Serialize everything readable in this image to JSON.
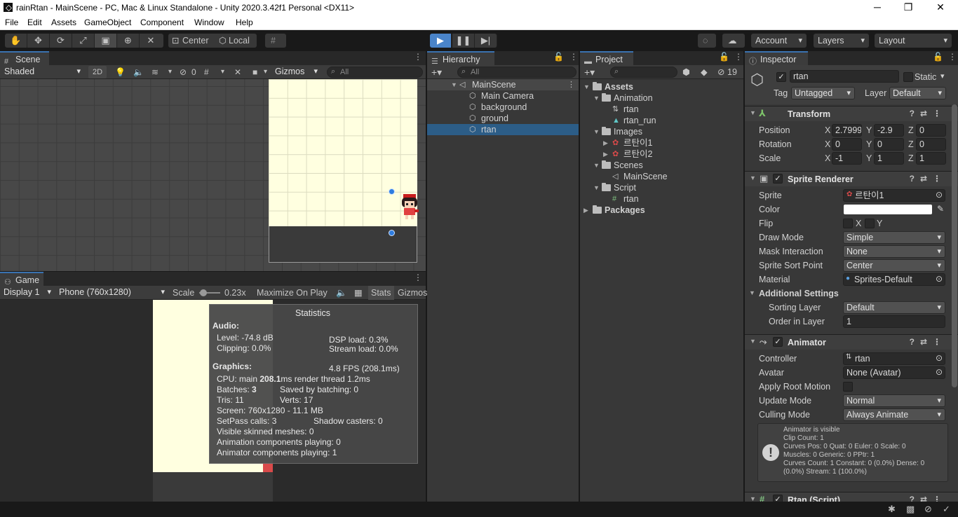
{
  "titlebar": {
    "title": "rainRtan - MainScene - PC, Mac & Linux Standalone - Unity 2020.3.42f1 Personal <DX11>",
    "minimize": "─",
    "restore": "❐",
    "close": "✕"
  },
  "menu": [
    "File",
    "Edit",
    "Assets",
    "GameObject",
    "Component",
    "Window",
    "Help"
  ],
  "toolbar": {
    "pivot": "Center",
    "space": "Local",
    "account": "Account",
    "layers": "Layers",
    "layout": "Layout"
  },
  "scene": {
    "tab": "Scene",
    "shading": "Shaded",
    "mode2d": "2D",
    "hidden_count": "0",
    "gizmos": "Gizmos",
    "search_placeholder": "All"
  },
  "game": {
    "tab": "Game",
    "display": "Display 1",
    "resolution": "Phone (760x1280)",
    "scale_label": "Scale",
    "scale_value": "0.23x",
    "maximize": "Maximize On Play",
    "stats": "Stats",
    "gizmos": "Gizmos"
  },
  "statistics": {
    "title": "Statistics",
    "audio_header": "Audio:",
    "level": "Level: -74.8 dB",
    "clipping": "Clipping: 0.0%",
    "dsp": "DSP load: 0.3%",
    "stream": "Stream load: 0.0%",
    "graphics_header": "Graphics:",
    "fps": "4.8 FPS (208.1ms)",
    "cpu_prefix": "CPU: main ",
    "cpu_main": "208.1",
    "cpu_suffix": "ms  render thread 1.2ms",
    "batches_prefix": "Batches: ",
    "batches": "3",
    "saved": "Saved by batching: 0",
    "tris": "Tris: 11",
    "verts": "Verts: 17",
    "screen": "Screen: 760x1280 - 11.1 MB",
    "setpass": "SetPass calls: 3",
    "shadow": "Shadow casters: 0",
    "skinned": "Visible skinned meshes: 0",
    "anim": "Animation components playing: 0",
    "animator": "Animator components playing: 1"
  },
  "hierarchy": {
    "tab": "Hierarchy",
    "search_placeholder": "All",
    "scene": "MainScene",
    "items": [
      "Main Camera",
      "background",
      "ground",
      "rtan"
    ]
  },
  "project": {
    "tab": "Project",
    "hidden_count": "19",
    "assets": "Assets",
    "animation": "Animation",
    "anim_items": [
      "rtan",
      "rtan_run"
    ],
    "images": "Images",
    "image_items": [
      "르탄이1",
      "르탄이2"
    ],
    "scenes": "Scenes",
    "scene_items": [
      "MainScene"
    ],
    "script": "Script",
    "script_items": [
      "rtan"
    ],
    "packages": "Packages"
  },
  "inspector": {
    "tab": "Inspector",
    "name": "rtan",
    "static": "Static",
    "tag_label": "Tag",
    "tag": "Untagged",
    "layer_label": "Layer",
    "layer": "Default",
    "transform": {
      "title": "Transform",
      "position_label": "Position",
      "rotation_label": "Rotation",
      "scale_label": "Scale",
      "position": {
        "x": "2.7999",
        "y": "-2.9",
        "z": "0"
      },
      "rotation": {
        "x": "0",
        "y": "0",
        "z": "0"
      },
      "scale": {
        "x": "-1",
        "y": "1",
        "z": "1"
      }
    },
    "sprite_renderer": {
      "title": "Sprite Renderer",
      "sprite_label": "Sprite",
      "sprite": "르탄이1",
      "color_label": "Color",
      "color_value": "#ffffff",
      "flip_label": "Flip",
      "flip_x": "X",
      "flip_y": "Y",
      "draw_mode_label": "Draw Mode",
      "draw_mode": "Simple",
      "mask_label": "Mask Interaction",
      "mask": "None",
      "sort_point_label": "Sprite Sort Point",
      "sort_point": "Center",
      "material_label": "Material",
      "material": "Sprites-Default",
      "additional": "Additional Settings",
      "sorting_layer_label": "Sorting Layer",
      "sorting_layer": "Default",
      "order_label": "Order in Layer",
      "order": "1"
    },
    "animator": {
      "title": "Animator",
      "controller_label": "Controller",
      "controller": "rtan",
      "avatar_label": "Avatar",
      "avatar": "None (Avatar)",
      "root_motion_label": "Apply Root Motion",
      "update_label": "Update Mode",
      "update": "Normal",
      "culling_label": "Culling Mode",
      "culling": "Always Animate",
      "info": [
        "Animator is visible",
        "Clip Count: 1",
        "Curves Pos: 0 Quat: 0 Euler: 0 Scale: 0",
        "Muscles: 0 Generic: 0 PPtr: 1",
        "Curves Count: 1 Constant: 0 (0.0%) Dense: 0",
        "(0.0%) Stream: 1 (100.0%)"
      ]
    },
    "script_component": "Rtan (Script)"
  },
  "colors": {
    "accent": "#3a72b0",
    "selection": "#2c5d87",
    "play": "#4a84c9"
  }
}
